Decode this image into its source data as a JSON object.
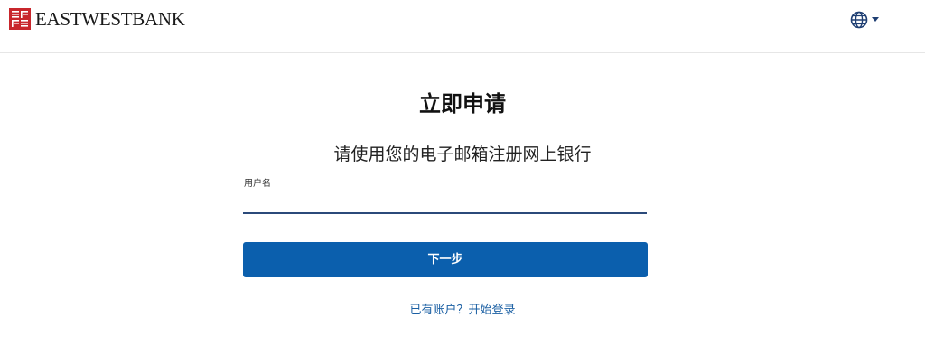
{
  "header": {
    "brand_name": "EASTWESTBANK",
    "language_icon": "globe-icon",
    "dropdown_icon": "caret-down-icon"
  },
  "main": {
    "title": "立即申请",
    "subtitle": "请使用您的电子邮箱注册网上银行",
    "username_label": "用户名",
    "username_value": "",
    "next_button": "下一步",
    "signin_link": "已有账户？开始登录"
  },
  "colors": {
    "brand_red": "#c8262c",
    "primary_blue": "#0b5fad",
    "link_blue": "#1a5fa3",
    "input_underline": "#2b4a7a"
  }
}
